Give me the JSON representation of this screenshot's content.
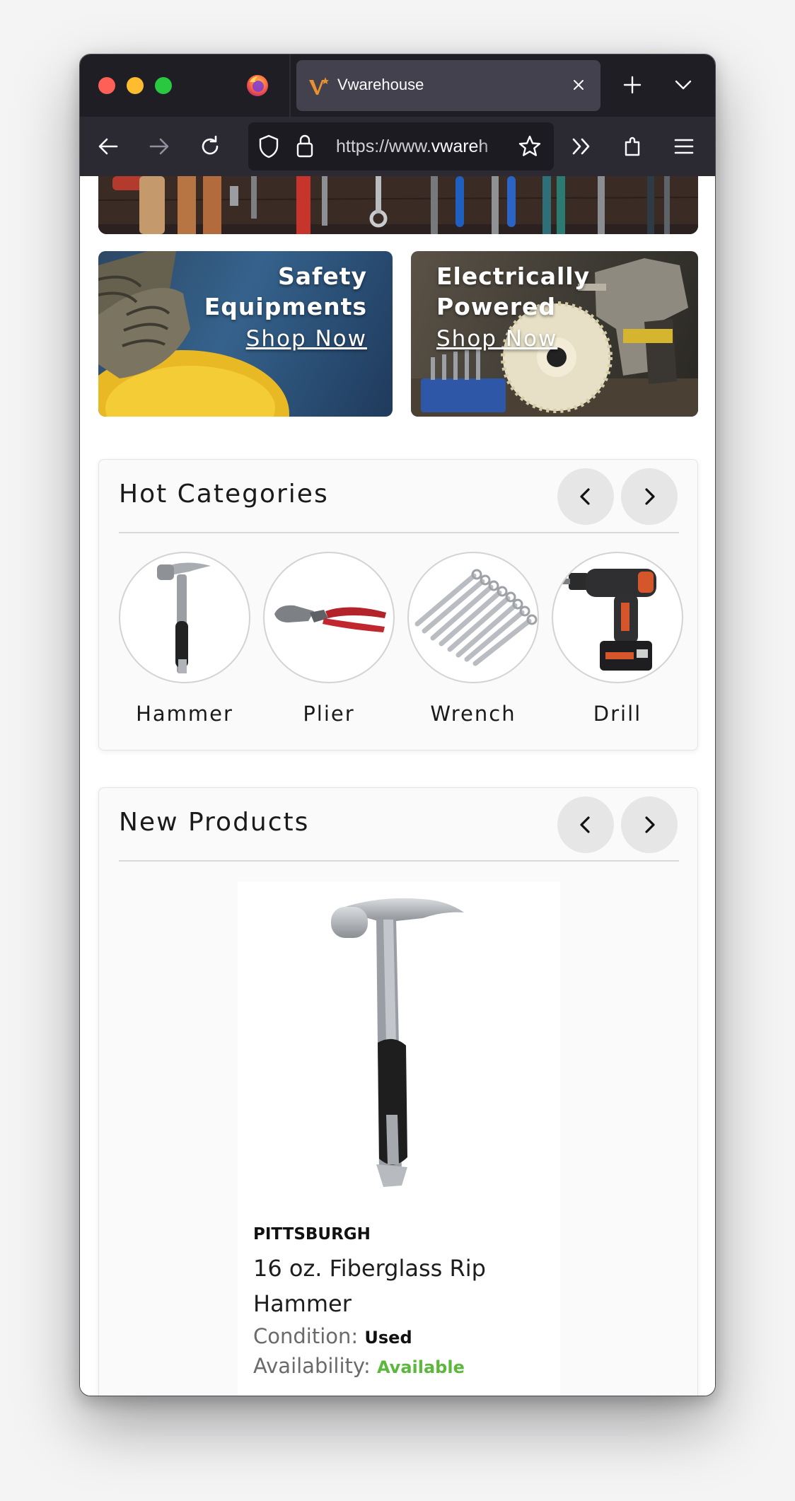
{
  "browser": {
    "tab_title": "Vwarehouse",
    "url_prefix": "https://www.",
    "url_highlight": "vwareh",
    "window_controls": [
      "close",
      "minimize",
      "maximize"
    ],
    "icons": [
      "firefox-logo",
      "back-arrow",
      "forward-arrow",
      "reload",
      "shield",
      "lock",
      "star",
      "overflow-chevrons",
      "extensions",
      "hamburger-menu",
      "new-tab-plus",
      "tab-list-chevron",
      "tab-close-x"
    ]
  },
  "banners": {
    "safety": {
      "title_line1": "Safety",
      "title_line2": "Equipments",
      "link": "Shop Now"
    },
    "electric": {
      "title_line1": "Electrically",
      "title_line2": "Powered",
      "link": "Shop Now"
    }
  },
  "hot_categories": {
    "title": "Hot Categories",
    "items": [
      {
        "label": "Hammer",
        "icon": "hammer"
      },
      {
        "label": "Plier",
        "icon": "plier"
      },
      {
        "label": "Wrench",
        "icon": "wrench-set"
      },
      {
        "label": "Drill",
        "icon": "cordless-drill"
      }
    ]
  },
  "new_products": {
    "title": "New Products",
    "product": {
      "brand": "PITTSBURGH",
      "name": "16 oz. Fiberglass Rip Hammer",
      "condition_label": "Condition:",
      "condition_value": "Used",
      "availability_label": "Availability:",
      "availability_value": "Available"
    }
  },
  "colors": {
    "browser_chrome": "#1f1e25",
    "toolbar": "#2b2a33",
    "available_green": "#5cb83c",
    "card_bg": "#fafafa"
  }
}
